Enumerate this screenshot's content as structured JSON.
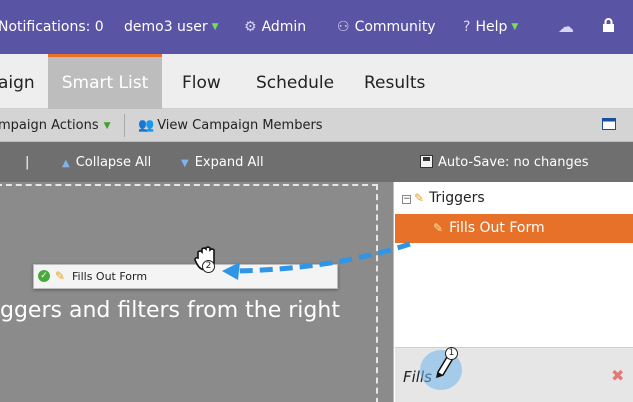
{
  "topbar": {
    "notifications": "Notifications: 0",
    "user": "demo3 user",
    "admin": "Admin",
    "community": "Community",
    "help": "Help"
  },
  "tabs": [
    "aign",
    "Smart List",
    "Flow",
    "Schedule",
    "Results"
  ],
  "actionbar": {
    "campaign_actions": "mpaign Actions",
    "view_members": "View Campaign Members"
  },
  "toolbar": {
    "separator": "|",
    "collapse_all": "Collapse All",
    "expand_all": "Expand All",
    "autosave": "Auto-Save: no changes"
  },
  "canvas": {
    "hint": "ggers and filters from the right",
    "drag_card_label": "Fills Out Form"
  },
  "panel": {
    "tree_group": "Triggers",
    "tree_selected": "Fills Out Form",
    "search_value": "Fills"
  },
  "annotations": {
    "step_1": "1",
    "step_2": "2"
  },
  "colors": {
    "topbar": "#5a54a4",
    "accent_orange": "#e8712a",
    "arrow_blue": "#2f95e6"
  }
}
